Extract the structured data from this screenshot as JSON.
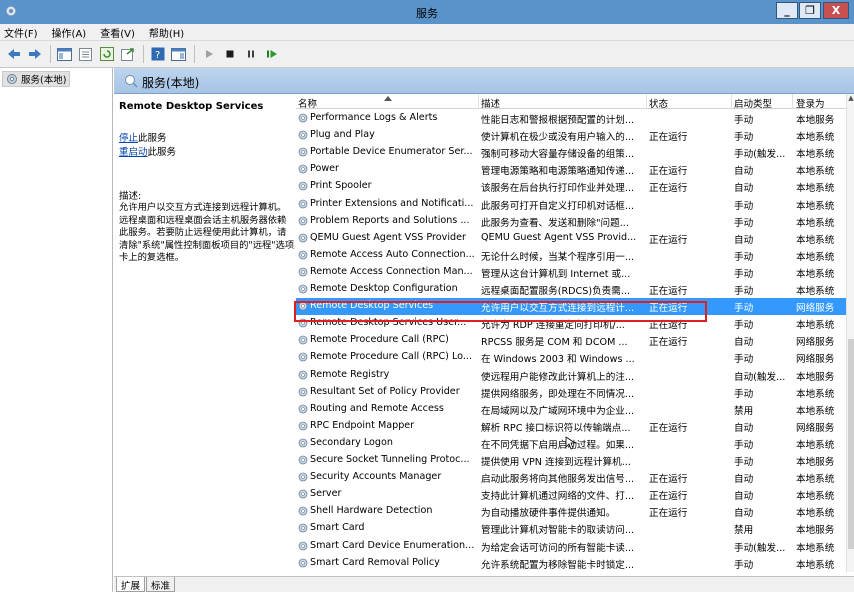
{
  "window": {
    "title": "服务"
  },
  "menu": [
    "文件(F)",
    "操作(A)",
    "查看(V)",
    "帮助(H)"
  ],
  "tree": {
    "root": "服务(本地)"
  },
  "main": {
    "header": "服务(本地)"
  },
  "description": {
    "service_name": "Remote Desktop Services",
    "stop_link": "停止",
    "stop_rest": "此服务",
    "restart_link": "重启动",
    "restart_rest": "此服务",
    "desc_label": "描述:",
    "desc_text": "允许用户以交互方式连接到远程计算机。远程桌面和远程桌面会话主机服务器依赖此服务。若要防止远程使用此计算机，请清除\"系统\"属性控制面板项目的\"远程\"选项卡上的复选框。"
  },
  "columns": [
    "名称",
    "描述",
    "状态",
    "启动类型",
    "登录为"
  ],
  "rows": [
    [
      "Performance Logs & Alerts",
      "性能日志和警报根据预配置的计划...",
      "",
      "手动",
      "本地服务"
    ],
    [
      "Plug and Play",
      "使计算机在极少或没有用户输入的...",
      "正在运行",
      "手动",
      "本地系统"
    ],
    [
      "Portable Device Enumerator Ser...",
      "强制可移动大容量存储设备的组策...",
      "",
      "手动(触发...",
      "本地系统"
    ],
    [
      "Power",
      "管理电源策略和电源策略通知传递...",
      "正在运行",
      "自动",
      "本地系统"
    ],
    [
      "Print Spooler",
      "该服务在后台执行打印作业并处理...",
      "正在运行",
      "自动",
      "本地系统"
    ],
    [
      "Printer Extensions and Notificati...",
      "此服务可打开自定义打印机对话框...",
      "",
      "手动",
      "本地系统"
    ],
    [
      "Problem Reports and Solutions ...",
      "此服务为查看、发送和删除\"问题...",
      "",
      "手动",
      "本地系统"
    ],
    [
      "QEMU Guest Agent VSS Provider",
      "QEMU Guest Agent VSS Provid...",
      "正在运行",
      "自动",
      "本地系统"
    ],
    [
      "Remote Access Auto Connection...",
      "无论什么时候，当某个程序引用一...",
      "",
      "手动",
      "本地系统"
    ],
    [
      "Remote Access Connection Man...",
      "管理从这台计算机到 Internet 或...",
      "",
      "手动",
      "本地系统"
    ],
    [
      "Remote Desktop Configuration",
      "远程桌面配置服务(RDCS)负责需...",
      "正在运行",
      "手动",
      "本地系统"
    ],
    [
      "Remote Desktop Services",
      "允许用户以交互方式连接到远程计...",
      "正在运行",
      "手动",
      "网络服务"
    ],
    [
      "Remote Desktop Services User...",
      "允许为 RDP 连接重定向打印机/...",
      "正在运行",
      "手动",
      "本地系统"
    ],
    [
      "Remote Procedure Call (RPC)",
      "RPCSS 服务是 COM 和 DCOM ...",
      "正在运行",
      "自动",
      "网络服务"
    ],
    [
      "Remote Procedure Call (RPC) Lo...",
      "在 Windows 2003 和 Windows ...",
      "",
      "手动",
      "网络服务"
    ],
    [
      "Remote Registry",
      "使远程用户能修改此计算机上的注...",
      "",
      "自动(触发...",
      "本地服务"
    ],
    [
      "Resultant Set of Policy Provider",
      "提供网络服务，即处理在不同情况...",
      "",
      "手动",
      "本地系统"
    ],
    [
      "Routing and Remote Access",
      "在局域网以及广域网环境中为企业...",
      "",
      "禁用",
      "本地系统"
    ],
    [
      "RPC Endpoint Mapper",
      "解析 RPC 接口标识符以传输端点...",
      "正在运行",
      "自动",
      "网络服务"
    ],
    [
      "Secondary Logon",
      "在不同凭据下启用启动过程。如果...",
      "",
      "手动",
      "本地系统"
    ],
    [
      "Secure Socket Tunneling Protoc...",
      "提供使用 VPN 连接到远程计算机...",
      "",
      "手动",
      "本地服务"
    ],
    [
      "Security Accounts Manager",
      "启动此服务将向其他服务发出信号...",
      "正在运行",
      "自动",
      "本地系统"
    ],
    [
      "Server",
      "支持此计算机通过网络的文件、打...",
      "正在运行",
      "自动",
      "本地系统"
    ],
    [
      "Shell Hardware Detection",
      "为自动播放硬件事件提供通知。",
      "正在运行",
      "自动",
      "本地系统"
    ],
    [
      "Smart Card",
      "管理此计算机对智能卡的取读访问...",
      "",
      "禁用",
      "本地服务"
    ],
    [
      "Smart Card Device Enumeration...",
      "为给定会话可访问的所有智能卡读...",
      "",
      "手动(触发...",
      "本地系统"
    ],
    [
      "Smart Card Removal Policy",
      "允许系统配置为移除智能卡时锁定...",
      "",
      "手动",
      "本地系统"
    ]
  ],
  "selected_row": 11,
  "tabs": [
    "扩展",
    "标准"
  ]
}
